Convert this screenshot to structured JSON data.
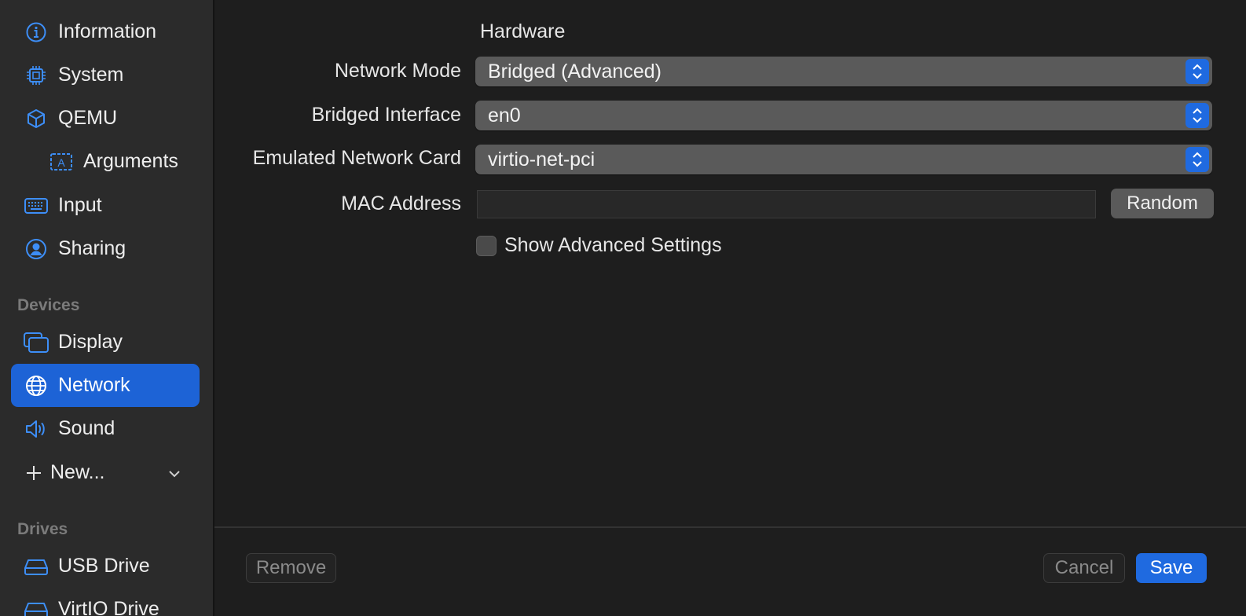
{
  "sidebar": {
    "items": [
      {
        "label": "Information",
        "icon": "info-circle-icon"
      },
      {
        "label": "System",
        "icon": "cpu-chip-icon"
      },
      {
        "label": "QEMU",
        "icon": "cube-icon"
      },
      {
        "label": "Arguments",
        "icon": "text-box-icon"
      },
      {
        "label": "Input",
        "icon": "keyboard-icon"
      },
      {
        "label": "Sharing",
        "icon": "person-circle-icon"
      }
    ],
    "devices_header": "Devices",
    "devices": [
      {
        "label": "Display",
        "icon": "display-windows-icon"
      },
      {
        "label": "Network",
        "icon": "globe-icon"
      },
      {
        "label": "Sound",
        "icon": "speaker-icon"
      }
    ],
    "new_label": "New...",
    "drives_header": "Drives",
    "drives": [
      {
        "label": "USB Drive",
        "icon": "drive-icon"
      },
      {
        "label": "VirtIO Drive",
        "icon": "drive-icon"
      }
    ]
  },
  "main": {
    "section_title": "Hardware",
    "network_mode": {
      "label": "Network Mode",
      "value": "Bridged (Advanced)"
    },
    "bridged_interface": {
      "label": "Bridged Interface",
      "value": "en0"
    },
    "network_card": {
      "label": "Emulated Network Card",
      "value": "virtio-net-pci"
    },
    "mac_address": {
      "label": "MAC Address",
      "value": "",
      "random_label": "Random"
    },
    "advanced_checkbox": {
      "label": "Show Advanced Settings",
      "checked": false
    }
  },
  "footer": {
    "remove_label": "Remove",
    "cancel_label": "Cancel",
    "save_label": "Save"
  },
  "colors": {
    "accent": "#1f6ae0",
    "active_row": "#1d63d6",
    "icon_blue": "#3d8ef7"
  }
}
